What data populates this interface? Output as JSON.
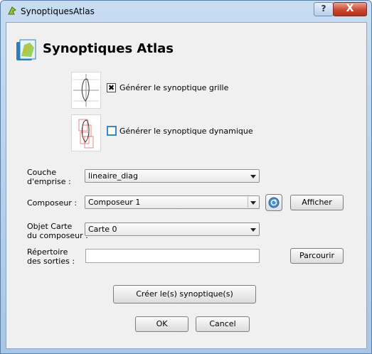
{
  "window": {
    "title": "SynoptiquesAtlas",
    "help_glyph": "?",
    "close_glyph": "X"
  },
  "header": {
    "title": "Synoptiques Atlas",
    "icon": "atlas-map-icon"
  },
  "options": {
    "grid": {
      "label": "Générer le synoptique grille",
      "checked": true
    },
    "dynamic": {
      "label": "Générer le synoptique dynamique",
      "checked": false
    }
  },
  "form": {
    "coverage_label_1": "Couche",
    "coverage_label_2": "d'emprise :",
    "coverage_value": "lineaire_diag",
    "composer_label": "Composeur :",
    "composer_value": "Composeur 1",
    "show_button": "Afficher",
    "map_label_1": "Objet Carte",
    "map_label_2": "du composeur :",
    "map_value": "Carte 0",
    "output_label_1": "Répertoire",
    "output_label_2": "des sorties :",
    "output_value": "",
    "browse_button": "Parcourir"
  },
  "actions": {
    "create": "Créer le(s) synoptique(s)",
    "ok": "OK",
    "cancel": "Cancel"
  }
}
